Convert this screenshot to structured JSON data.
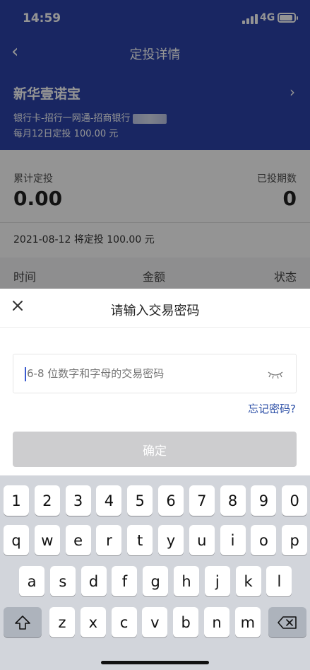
{
  "status_bar": {
    "time": "14:59",
    "network": "4G"
  },
  "nav": {
    "title": "定投详情"
  },
  "fund": {
    "name": "新华壹诺宝",
    "bank": "银行卡-招行一网通-招商银行",
    "plan": "每月12日定投 100.00 元"
  },
  "summary": {
    "total_label": "累计定投",
    "total_value": "0.00",
    "periods_label": "已投期数",
    "periods_value": "0",
    "next_plan": "2021-08-12 将定投 100.00 元"
  },
  "table": {
    "headers": [
      "时间",
      "金额",
      "状态"
    ]
  },
  "dialog": {
    "title": "请输入交易密码",
    "placeholder": "6-8 位数字和字母的交易密码",
    "forgot": "忘记密码?",
    "confirm": "确定"
  },
  "keyboard": {
    "row1": [
      "1",
      "2",
      "3",
      "4",
      "5",
      "6",
      "7",
      "8",
      "9",
      "0"
    ],
    "row2": [
      "q",
      "w",
      "e",
      "r",
      "t",
      "y",
      "u",
      "i",
      "o",
      "p"
    ],
    "row3": [
      "a",
      "s",
      "d",
      "f",
      "g",
      "h",
      "j",
      "k",
      "l"
    ],
    "row4": [
      "z",
      "x",
      "c",
      "v",
      "b",
      "n",
      "m"
    ]
  },
  "colors": {
    "header_blue": "#2b43a9",
    "link_blue": "#2b4ea6",
    "button_disabled": "#cdcdcf"
  }
}
